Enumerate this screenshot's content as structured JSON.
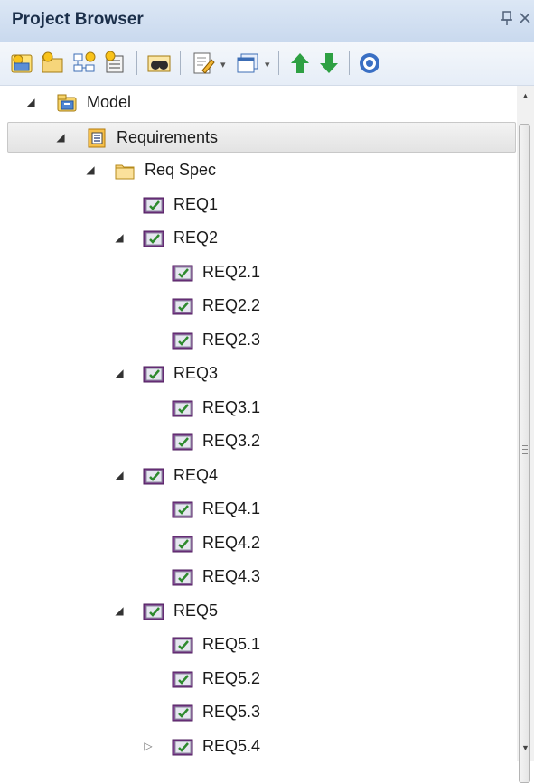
{
  "window": {
    "title": "Project Browser",
    "pin_icon": "pin-icon",
    "close_icon": "close-icon"
  },
  "toolbar": {
    "buttons": [
      {
        "name": "new-model-icon"
      },
      {
        "name": "new-package-icon"
      },
      {
        "name": "new-diagram-icon"
      },
      {
        "name": "new-element-icon"
      },
      {
        "name": "find-binoculars-icon"
      },
      {
        "name": "document-edit-icon"
      },
      {
        "name": "window-view-icon"
      },
      {
        "name": "move-up-arrow-icon"
      },
      {
        "name": "move-down-arrow-icon"
      },
      {
        "name": "help-icon"
      }
    ],
    "colors": {
      "up_arrow": "#2ea043",
      "down_arrow": "#2ea043",
      "help": "#3a6fc4"
    }
  },
  "tree": {
    "nodes": [
      {
        "label": "Model",
        "icon": "model-root-icon",
        "twisty": "expanded",
        "depth": 0
      },
      {
        "label": "Requirements",
        "icon": "package-view-icon",
        "twisty": "expanded",
        "depth": 1,
        "selected": true
      },
      {
        "label": "Req Spec",
        "icon": "folder-icon",
        "twisty": "expanded",
        "depth": 2
      },
      {
        "label": "REQ1",
        "icon": "requirement-icon",
        "twisty": "none",
        "depth": 3
      },
      {
        "label": "REQ2",
        "icon": "requirement-icon",
        "twisty": "expanded",
        "depth": 3
      },
      {
        "label": "REQ2.1",
        "icon": "requirement-icon",
        "twisty": "none",
        "depth": 4
      },
      {
        "label": "REQ2.2",
        "icon": "requirement-icon",
        "twisty": "none",
        "depth": 4
      },
      {
        "label": "REQ2.3",
        "icon": "requirement-icon",
        "twisty": "none",
        "depth": 4
      },
      {
        "label": "REQ3",
        "icon": "requirement-icon",
        "twisty": "expanded",
        "depth": 3
      },
      {
        "label": "REQ3.1",
        "icon": "requirement-icon",
        "twisty": "none",
        "depth": 4
      },
      {
        "label": "REQ3.2",
        "icon": "requirement-icon",
        "twisty": "none",
        "depth": 4
      },
      {
        "label": "REQ4",
        "icon": "requirement-icon",
        "twisty": "expanded",
        "depth": 3
      },
      {
        "label": "REQ4.1",
        "icon": "requirement-icon",
        "twisty": "none",
        "depth": 4
      },
      {
        "label": "REQ4.2",
        "icon": "requirement-icon",
        "twisty": "none",
        "depth": 4
      },
      {
        "label": "REQ4.3",
        "icon": "requirement-icon",
        "twisty": "none",
        "depth": 4
      },
      {
        "label": "REQ5",
        "icon": "requirement-icon",
        "twisty": "expanded",
        "depth": 3
      },
      {
        "label": "REQ5.1",
        "icon": "requirement-icon",
        "twisty": "none",
        "depth": 4
      },
      {
        "label": "REQ5.2",
        "icon": "requirement-icon",
        "twisty": "none",
        "depth": 4
      },
      {
        "label": "REQ5.3",
        "icon": "requirement-icon",
        "twisty": "none",
        "depth": 4
      },
      {
        "label": "REQ5.4",
        "icon": "requirement-icon",
        "twisty": "collapsed",
        "depth": 4
      }
    ]
  },
  "scrollbar": {
    "up_icon": "scroll-up-icon",
    "down_icon": "scroll-down-icon"
  }
}
